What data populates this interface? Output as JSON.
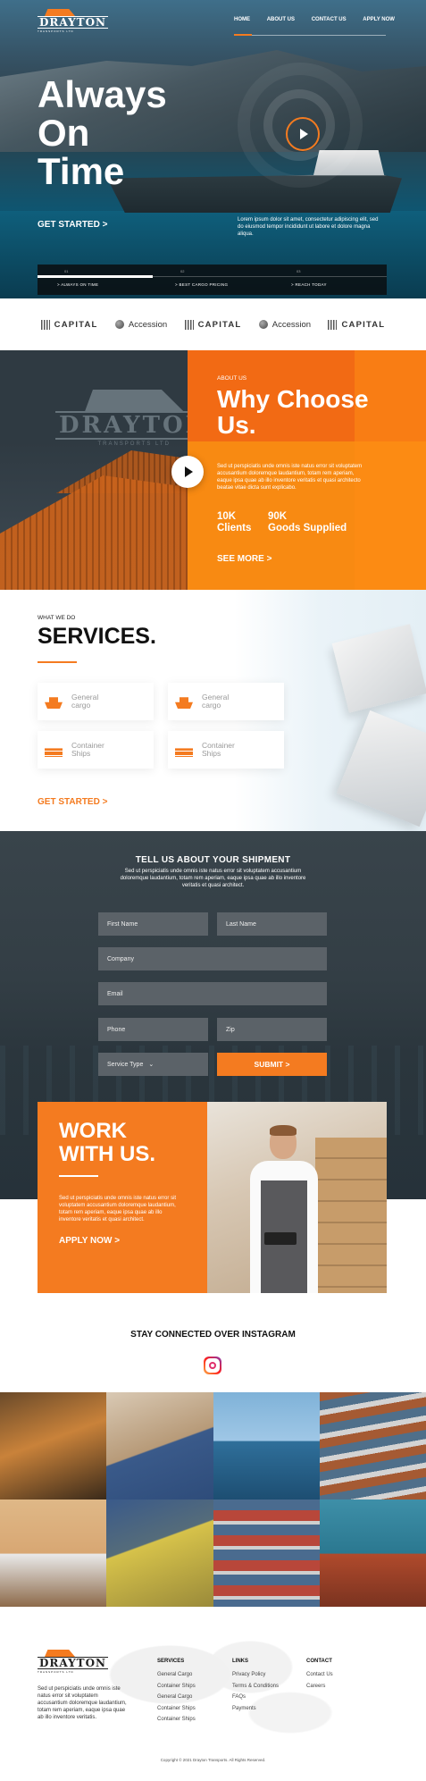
{
  "brand": {
    "name": "DRAYTON",
    "tagline": "TRANSPORTS LTD"
  },
  "nav": {
    "items": [
      "HOME",
      "ABOUT US",
      "CONTACT US",
      "APPLY NOW"
    ],
    "active": "HOME"
  },
  "hero": {
    "title": "Always\nOn\nTime",
    "cta": "GET STARTED >",
    "text": "Lorem ipsum dolor sit amet, consectetur adipiscing elit, sed do eiusmod tempor incididunt ut labore et dolore magna aliqua.",
    "tabs": [
      {
        "num": "01",
        "label": "> ALWAYS ON TIME"
      },
      {
        "num": "02",
        "label": "> BEST CARGO PRICING"
      },
      {
        "num": "03",
        "label": "> REACH TODAY"
      }
    ],
    "progress": 0.33
  },
  "partners": [
    {
      "name": "CAPITAL",
      "icon": "capital-logo-icon"
    },
    {
      "name": "Accession",
      "icon": "accession-logo-icon"
    },
    {
      "name": "CAPITAL",
      "icon": "capital-logo-icon"
    },
    {
      "name": "Accession",
      "icon": "accession-logo-icon"
    },
    {
      "name": "CAPITAL",
      "icon": "capital-logo-icon"
    }
  ],
  "why": {
    "eyebrow": "ABOUT US",
    "title": "Why Choose\nUs.",
    "description": "Sed ut perspiciatis unde omnis iste natus error sit voluptatem accusantium doloremque laudantium, totam rem aperiam, eaque ipsa quae ab illo inventore veritatis et quasi architecto beatae vitae dicta sunt explicabo.",
    "stats": [
      {
        "value": "10K",
        "label": "Clients"
      },
      {
        "value": "90K",
        "label": "Goods Supplied"
      }
    ],
    "cta": "SEE MORE >"
  },
  "services": {
    "eyebrow": "WHAT WE DO",
    "title": "SERVICES.",
    "items": [
      {
        "label": "General\ncargo",
        "icon": "ship-icon"
      },
      {
        "label": "General\ncargo",
        "icon": "ship-icon"
      },
      {
        "label": "Container\nShips",
        "icon": "container-ship-icon"
      },
      {
        "label": "Container\nShips",
        "icon": "container-ship-icon"
      }
    ],
    "cta": "GET STARTED >"
  },
  "shipment": {
    "title": "TELL US ABOUT YOUR SHIPMENT",
    "subtitle": "Sed ut perspiciatis unde omnis iste natus error sit voluptatem accusantium doloremque laudantium, totam rem aperiam, eaque ipsa quae ab illo inventore veritatis et quasi architect.",
    "fields": {
      "first_name": "First Name",
      "last_name": "Last Name",
      "company": "Company",
      "email": "Email",
      "phone": "Phone",
      "zip": "Zip",
      "service_type": "Service Type"
    },
    "submit": "SUBMIT >"
  },
  "work": {
    "title": "WORK\nWITH US.",
    "description": "Sed ut perspiciatis unde omnis iste natus error sit voluptatem accusantium doloremque laudantium, totam rem aperiam, eaque ipsa quae ab illo inventore veritatis et quasi architect.",
    "cta": "APPLY NOW >"
  },
  "instagram": {
    "title": "STAY CONNECTED OVER INSTAGRAM"
  },
  "footer": {
    "about": "Sed ut perspiciatis unde omnis iste natus error sit voluptatem accusantium doloremque laudantium, totam rem aperiam, eaque ipsa quae ab illo inventore veritatis.",
    "columns": [
      {
        "title": "SERVICES",
        "links": [
          "General Cargo",
          "Container Ships",
          "General Cargo",
          "Container Ships",
          "Container Ships"
        ]
      },
      {
        "title": "LINKS",
        "links": [
          "Privacy Policy",
          "Terms & Conditions",
          "FAQs",
          "Payments"
        ]
      },
      {
        "title": "CONTACT",
        "links": [
          "Contact Us",
          "Careers"
        ]
      }
    ],
    "copyright": "Copyright © 2021 Drayton Transports. All Rights Reserved."
  },
  "colors": {
    "accent": "#f47b20",
    "dark": "#2f3a42"
  }
}
